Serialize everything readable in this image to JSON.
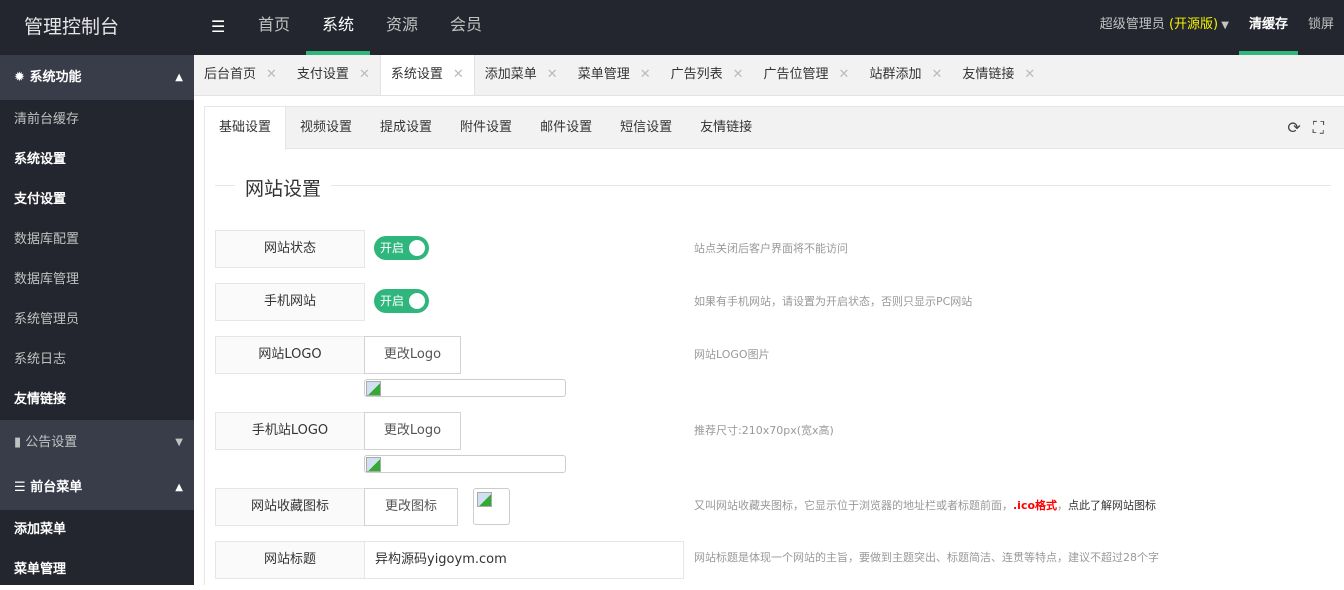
{
  "header": {
    "title": "管理控制台",
    "nav": [
      "首页",
      "系统",
      "资源",
      "会员"
    ],
    "active_nav": 1,
    "user": "超级管理员",
    "version": "(开源版)",
    "clear_cache": "清缓存",
    "lock": "锁屏"
  },
  "sidebar": {
    "sec1": "系统功能",
    "items1": [
      "清前台缓存",
      "系统设置",
      "支付设置",
      "数据库配置",
      "数据库管理",
      "系统管理员",
      "系统日志",
      "友情链接"
    ],
    "sec2": "公告设置",
    "sec3": "前台菜单",
    "items3": [
      "添加菜单",
      "菜单管理"
    ]
  },
  "tabs": [
    "后台首页",
    "支付设置",
    "系统设置",
    "添加菜单",
    "菜单管理",
    "广告列表",
    "广告位管理",
    "站群添加",
    "友情链接"
  ],
  "active_tab": 2,
  "subtabs": [
    "基础设置",
    "视频设置",
    "提成设置",
    "附件设置",
    "邮件设置",
    "短信设置",
    "友情链接"
  ],
  "legend": "网站设置",
  "form": {
    "status": {
      "label": "网站状态",
      "toggle": "开启",
      "on": true,
      "hint": "站点关闭后客户界面将不能访问"
    },
    "mobile": {
      "label": "手机网站",
      "toggle": "开启",
      "on": true,
      "hint": "如果有手机网站，请设置为开启状态，否则只显示PC网站"
    },
    "logo": {
      "label": "网站LOGO",
      "button": "更改Logo",
      "hint": "网站LOGO图片"
    },
    "mlogo": {
      "label": "手机站LOGO",
      "button": "更改Logo",
      "hint": "推荐尺寸:210x70px(宽x高)"
    },
    "favicon": {
      "label": "网站收藏图标",
      "button": "更改图标",
      "hint": "又叫网站收藏夹图标，它显示位于浏览器的地址栏或者标题前面，",
      "hint_red": ".ico格式",
      "hint_sep": "，",
      "hint_link": "点此了解网站图标"
    },
    "title": {
      "label": "网站标题",
      "value": "异构源码yigoym.com",
      "hint": "网站标题是体现一个网站的主旨，要做到主题突出、标题简洁、连贯等特点，建议不超过28个字"
    }
  },
  "colors": {
    "accent": "#2fb67c",
    "header_bg": "#23262e",
    "sidebar_section_bg": "#393d49",
    "version": "#f3f300"
  }
}
